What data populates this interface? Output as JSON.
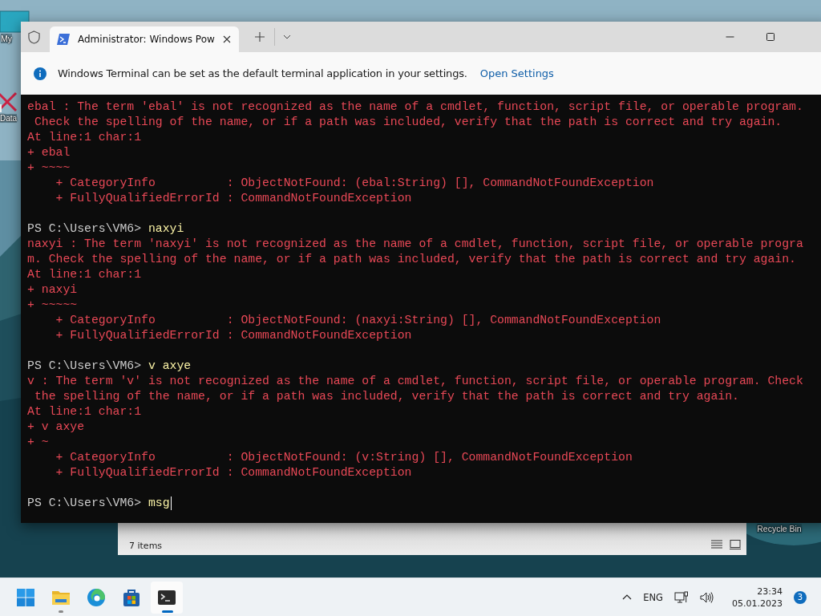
{
  "desktop": {
    "icons": [
      {
        "label": "My",
        "kind": "computer"
      },
      {
        "label": "Data",
        "kind": "shortcut"
      },
      {
        "label": "Recycle Bin",
        "kind": "recycle"
      }
    ]
  },
  "explorer_window": {
    "status": "7 items"
  },
  "terminal": {
    "tabs": [
      {
        "title": "Administrator: Windows Pow",
        "selected": true
      }
    ],
    "infobar": {
      "message": "Windows Terminal can be set as the default terminal application in your settings.",
      "link": "Open Settings"
    },
    "lines": [
      {
        "kind": "error",
        "text": "ebal : The term 'ebal' is not recognized as the name of a cmdlet, function, script file, or operable program."
      },
      {
        "kind": "error",
        "text": " Check the spelling of the name, or if a path was included, verify that the path is correct and try again."
      },
      {
        "kind": "error",
        "text": "At line:1 char:1"
      },
      {
        "kind": "error",
        "text": "+ ebal"
      },
      {
        "kind": "error",
        "text": "+ ~~~~"
      },
      {
        "kind": "error",
        "text": "    + CategoryInfo          : ObjectNotFound: (ebal:String) [], CommandNotFoundException"
      },
      {
        "kind": "error",
        "text": "    + FullyQualifiedErrorId : CommandNotFoundException"
      },
      {
        "kind": "blank"
      },
      {
        "kind": "prompt",
        "prompt": "PS C:\\Users\\VM6>",
        "command": "naxyi",
        "cursor": false
      },
      {
        "kind": "error",
        "text": "naxyi : The term 'naxyi' is not recognized as the name of a cmdlet, function, script file, or operable progra"
      },
      {
        "kind": "error",
        "text": "m. Check the spelling of the name, or if a path was included, verify that the path is correct and try again."
      },
      {
        "kind": "error",
        "text": "At line:1 char:1"
      },
      {
        "kind": "error",
        "text": "+ naxyi"
      },
      {
        "kind": "error",
        "text": "+ ~~~~~"
      },
      {
        "kind": "error",
        "text": "    + CategoryInfo          : ObjectNotFound: (naxyi:String) [], CommandNotFoundException"
      },
      {
        "kind": "error",
        "text": "    + FullyQualifiedErrorId : CommandNotFoundException"
      },
      {
        "kind": "blank"
      },
      {
        "kind": "prompt",
        "prompt": "PS C:\\Users\\VM6>",
        "command": "v axye",
        "cursor": false
      },
      {
        "kind": "error",
        "text": "v : The term 'v' is not recognized as the name of a cmdlet, function, script file, or operable program. Check"
      },
      {
        "kind": "error",
        "text": " the spelling of the name, or if a path was included, verify that the path is correct and try again."
      },
      {
        "kind": "error",
        "text": "At line:1 char:1"
      },
      {
        "kind": "error",
        "text": "+ v axye"
      },
      {
        "kind": "error",
        "text": "+ ~"
      },
      {
        "kind": "error",
        "text": "    + CategoryInfo          : ObjectNotFound: (v:String) [], CommandNotFoundException"
      },
      {
        "kind": "error",
        "text": "    + FullyQualifiedErrorId : CommandNotFoundException"
      },
      {
        "kind": "blank"
      },
      {
        "kind": "prompt",
        "prompt": "PS C:\\Users\\VM6>",
        "command": "msg",
        "cursor": true
      }
    ]
  },
  "taskbar": {
    "apps": [
      {
        "kind": "start",
        "selected": false,
        "running": false
      },
      {
        "kind": "folder",
        "selected": false,
        "running": true
      },
      {
        "kind": "edge",
        "selected": false,
        "running": false
      },
      {
        "kind": "store",
        "selected": false,
        "running": false
      },
      {
        "kind": "terminal",
        "selected": true,
        "running": true
      }
    ],
    "language": "ENG",
    "time": "23:34",
    "date": "05.01.2023",
    "notifications": "3"
  }
}
